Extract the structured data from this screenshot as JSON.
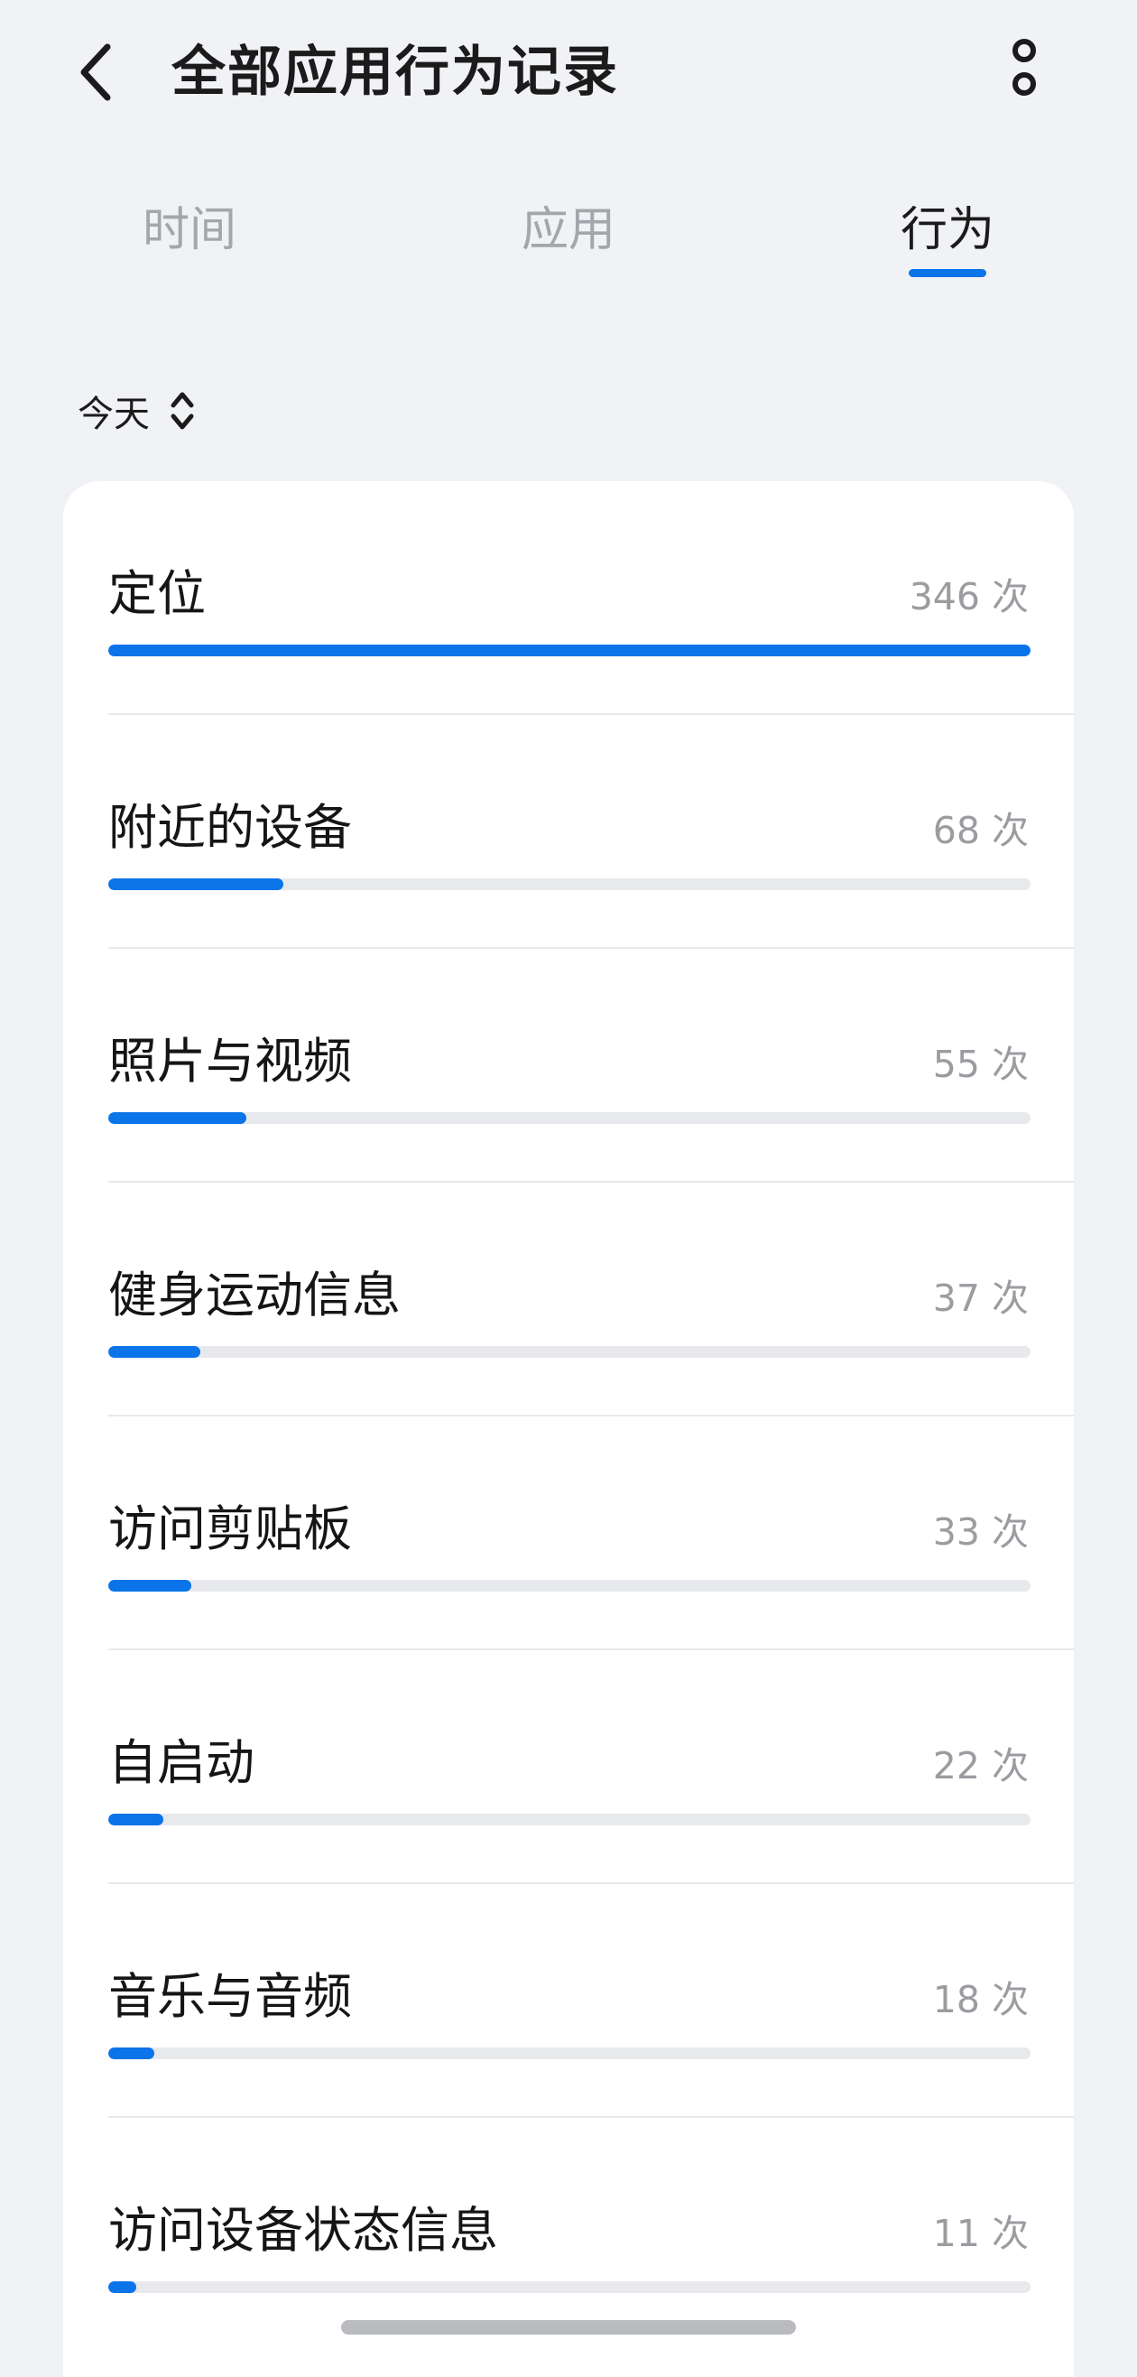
{
  "header": {
    "title": "全部应用行为记录",
    "back_icon": "chevron-left-icon",
    "more_icon": "more-vertical-icon"
  },
  "tabs": [
    {
      "label": "时间",
      "active": false
    },
    {
      "label": "应用",
      "active": false
    },
    {
      "label": "行为",
      "active": true
    }
  ],
  "filter": {
    "label": "今天",
    "icon": "chevron-up-down-icon"
  },
  "behaviors": [
    {
      "label": "定位",
      "count": "346 次",
      "fraction": 1.0
    },
    {
      "label": "附近的设备",
      "count": "68 次",
      "fraction": 0.19
    },
    {
      "label": "照片与视频",
      "count": "55 次",
      "fraction": 0.15
    },
    {
      "label": "健身运动信息",
      "count": "37 次",
      "fraction": 0.1
    },
    {
      "label": "访问剪贴板",
      "count": "33 次",
      "fraction": 0.09
    },
    {
      "label": "自启动",
      "count": "22 次",
      "fraction": 0.06
    },
    {
      "label": "音乐与音频",
      "count": "18 次",
      "fraction": 0.05
    },
    {
      "label": "访问设备状态信息",
      "count": "11 次",
      "fraction": 0.03
    }
  ],
  "colors": {
    "accent": "#0a74e8",
    "track": "#e8e9ec",
    "background": "#f1f2f6",
    "card": "#ffffff"
  }
}
